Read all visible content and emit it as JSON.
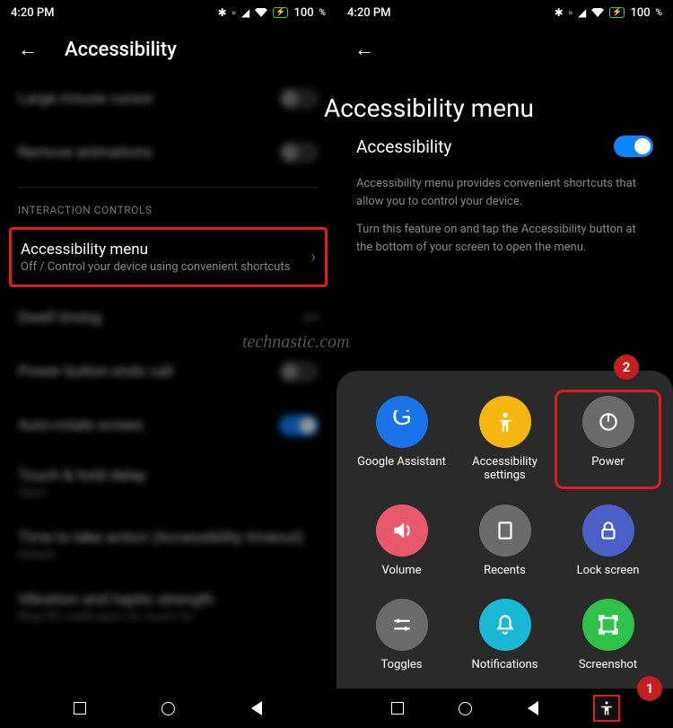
{
  "status": {
    "time": "4:20 PM",
    "battery": "100",
    "percent_suffix": "%"
  },
  "left": {
    "title": "Accessibility",
    "row_large_cursor": "Large mouse cursor",
    "row_remove_anim": "Remove animations",
    "section_interaction": "INTERACTION CONTROLS",
    "menu_row_title": "Accessibility menu",
    "menu_row_sub": "Off / Control your device using convenient shortcuts",
    "row_dwell": "Dwell timing",
    "row_dwell_sub": "Off",
    "row_power_ends": "Power button ends call",
    "row_autorotate": "Auto-rotate screen",
    "row_touch_hold": "Touch & hold delay",
    "row_touch_hold_sub": "Short",
    "row_time_action": "Time to take action (Accessibility timeout)",
    "row_time_action_sub": "Default",
    "row_vibration": "Vibration and haptic strength",
    "row_vibration_sub": "Ring Off, notification On, touch On"
  },
  "right": {
    "title": "Accessibility menu",
    "toggle_label": "Accessibility",
    "desc1": "Accessibility menu provides convenient shortcuts that allow you to control your device.",
    "desc2": "Turn this feature on and tap the Accessibility button at the bottom of your screen to open the menu.",
    "menu": {
      "items": [
        {
          "label": "Google Assistant",
          "color": "#1a73e8",
          "icon": "G"
        },
        {
          "label": "Accessibility settings",
          "color": "#f5b70f",
          "icon": "person"
        },
        {
          "label": "Power",
          "color": "#6b6b6b",
          "icon": "power",
          "highlight": true
        },
        {
          "label": "Volume",
          "color": "#e85a6b",
          "icon": "volume"
        },
        {
          "label": "Recents",
          "color": "#6b6b6b",
          "icon": "recents"
        },
        {
          "label": "Lock screen",
          "color": "#4a5fc7",
          "icon": "lock"
        },
        {
          "label": "Toggles",
          "color": "#6b6b6b",
          "icon": "toggles"
        },
        {
          "label": "Notifications",
          "color": "#1ab8d4",
          "icon": "bell"
        },
        {
          "label": "Screenshot",
          "color": "#2ec24a",
          "icon": "screenshot"
        }
      ]
    }
  },
  "annotations": {
    "badge1": "1",
    "badge2": "2"
  },
  "watermark": "technastic.com"
}
